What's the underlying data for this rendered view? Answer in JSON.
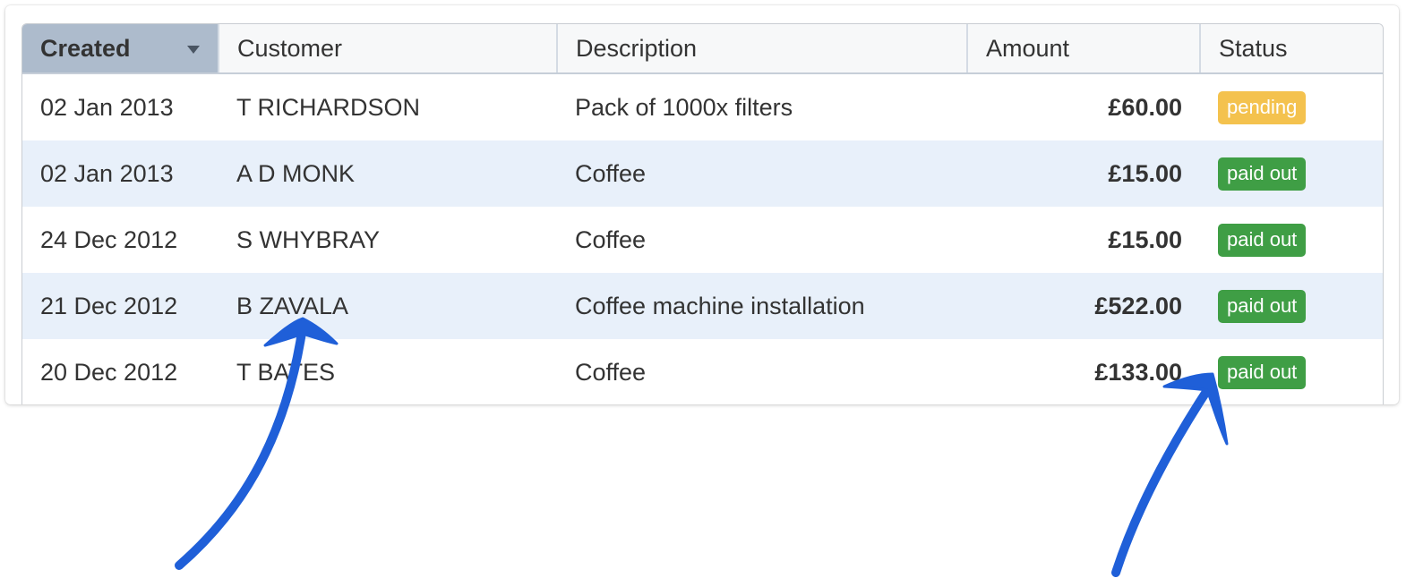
{
  "columns": {
    "created": "Created",
    "customer": "Customer",
    "description": "Description",
    "amount": "Amount",
    "status": "Status"
  },
  "rows": [
    {
      "created": "02 Jan 2013",
      "customer": "T RICHARDSON",
      "description": "Pack of 1000x filters",
      "amount": "£60.00",
      "status": "pending"
    },
    {
      "created": "02 Jan 2013",
      "customer": "A D MONK",
      "description": "Coffee",
      "amount": "£15.00",
      "status": "paid out"
    },
    {
      "created": "24 Dec 2012",
      "customer": "S WHYBRAY",
      "description": "Coffee",
      "amount": "£15.00",
      "status": "paid out"
    },
    {
      "created": "21 Dec 2012",
      "customer": "B ZAVALA",
      "description": "Coffee machine installation",
      "amount": "£522.00",
      "status": "paid out"
    },
    {
      "created": "20 Dec 2012",
      "customer": "T BATES",
      "description": "Coffee",
      "amount": "£133.00",
      "status": "paid out"
    }
  ],
  "status_colors": {
    "pending": "#f4c24e",
    "paid out": "#3f9e45"
  },
  "sort": {
    "column": "created",
    "direction": "descending",
    "icon": "caret-down-icon"
  },
  "annotation_color": "#1f5fd8"
}
